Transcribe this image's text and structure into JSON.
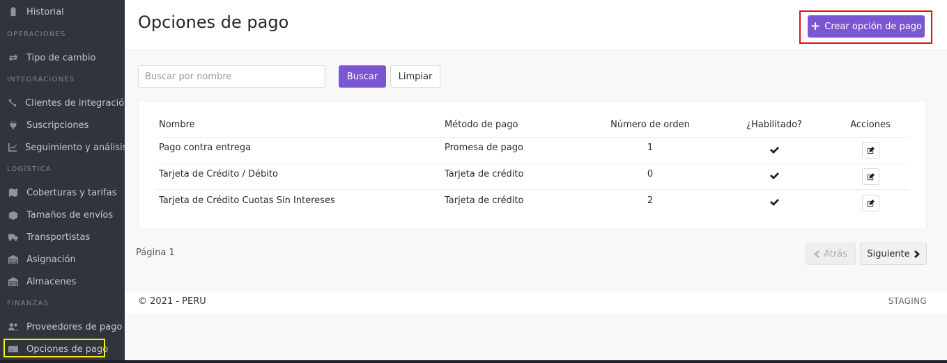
{
  "sidebar": {
    "top_item": {
      "label": "Historial",
      "icon": "clipboard-icon"
    },
    "sections": [
      {
        "title": "OPERACIONES",
        "items": [
          {
            "label": "Tipo de cambio",
            "icon": "exchange-icon"
          }
        ]
      },
      {
        "title": "INTEGRACIONES",
        "items": [
          {
            "label": "Clientes de integración",
            "icon": "integration-icon"
          },
          {
            "label": "Suscripciones",
            "icon": "plug-icon"
          },
          {
            "label": "Seguimiento y análisis",
            "icon": "chart-line-icon"
          }
        ]
      },
      {
        "title": "LOGÍSTICA",
        "items": [
          {
            "label": "Coberturas y tarifas",
            "icon": "map-icon"
          },
          {
            "label": "Tamaños de envíos",
            "icon": "box-icon"
          },
          {
            "label": "Transportistas",
            "icon": "truck-icon"
          },
          {
            "label": "Asignación",
            "icon": "warehouse-icon"
          },
          {
            "label": "Almacenes",
            "icon": "warehouse-icon"
          }
        ]
      },
      {
        "title": "FINANZAS",
        "items": [
          {
            "label": "Proveedores de pago",
            "icon": "users-icon"
          },
          {
            "label": "Opciones de pago",
            "icon": "credit-card-icon"
          }
        ]
      }
    ]
  },
  "header": {
    "title": "Opciones de pago",
    "create_button": "Crear opción de pago"
  },
  "search": {
    "placeholder": "Buscar por nombre",
    "value": "",
    "search_button": "Buscar",
    "clear_button": "Limpiar"
  },
  "table": {
    "columns": [
      "Nombre",
      "Método de pago",
      "Número de orden",
      "¿Habilitado?",
      "Acciones"
    ],
    "rows": [
      {
        "name": "Pago contra entrega",
        "method": "Promesa de pago",
        "order": "1",
        "enabled": true
      },
      {
        "name": "Tarjeta de Crédito / Débito",
        "method": "Tarjeta de crédito",
        "order": "0",
        "enabled": true
      },
      {
        "name": "Tarjeta de Crédito Cuotas Sin Intereses",
        "method": "Tarjeta de crédito",
        "order": "2",
        "enabled": true
      }
    ]
  },
  "pagination": {
    "page_label": "Página 1",
    "prev": "Atrás",
    "next": "Siguiente"
  },
  "footer": {
    "copyright": "© 2021 - PERU",
    "environment": "STAGING"
  },
  "colors": {
    "accent": "#7a56d2",
    "sidebar_bg": "#2f343d",
    "highlight_red": "#e01010",
    "highlight_yellow": "#f7ec12"
  }
}
